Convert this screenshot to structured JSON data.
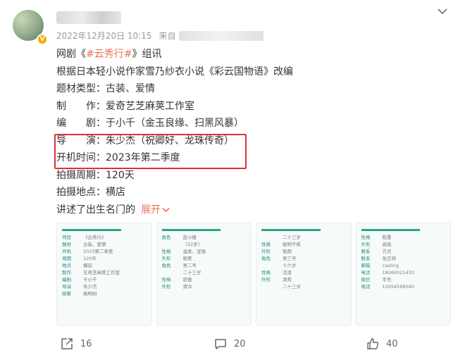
{
  "post": {
    "timestamp": "2022年12月20日 10:15",
    "source_prefix": "来自",
    "lines": [
      {
        "pre": "网剧《",
        "tag": "#云秀行#",
        "post": "》组讯"
      },
      {
        "text": "根据日本轻小说作家雪乃纱衣小说《彩云国物语》改编"
      },
      {
        "text": "题材类型：古装、爱情"
      },
      {
        "text": "制　　作：爱奇艺芝麻荚工作室"
      },
      {
        "text": "编　　剧：于小千（金玉良缘、扫黑风暴）"
      },
      {
        "text": "导　　演：朱少杰（祝卿好、龙珠传奇）"
      },
      {
        "text": "开机时间：2023年第二季度"
      },
      {
        "text": "拍摄周期：120天"
      },
      {
        "text": "拍摄地点：横店"
      },
      {
        "text": "讲述了出生名门的"
      }
    ],
    "expand_label": "展开"
  },
  "gallery": [
    {
      "rows": [
        [
          "项目",
          "《云秀行》"
        ],
        [
          "题材",
          "古装、爱情"
        ],
        [
          "开机",
          "2023第二季度"
        ],
        [
          "周期",
          "120天"
        ],
        [
          "地点",
          "横店"
        ],
        [
          "制作",
          "艺奇芝麻荚工作室"
        ],
        [
          "编剧",
          "于小千"
        ],
        [
          "导演",
          "朱少杰"
        ],
        [
          "统筹",
          "杨明树"
        ]
      ]
    },
    {
      "rows": [
        [
          "角色",
          "蓝小楼"
        ],
        [
          "",
          "（22岁）"
        ],
        [
          "性格",
          "温柔、坚强"
        ],
        [
          "外形",
          "貌美"
        ],
        [
          "角色",
          "男二号"
        ],
        [
          "",
          "二十三岁"
        ],
        [
          "性格",
          "骄傲"
        ],
        [
          "外形",
          "清冷"
        ]
      ]
    },
    {
      "rows": [
        [
          "",
          "二十三岁"
        ],
        [
          "性格",
          "聪明干练"
        ],
        [
          "外形",
          "俊朗"
        ],
        [
          "角色",
          "男三号"
        ],
        [
          "",
          "十六岁"
        ],
        [
          "性格",
          "活泼"
        ],
        [
          "外形",
          "清秀"
        ],
        [
          "",
          "二十三岁"
        ]
      ]
    },
    {
      "rows": [
        [
          "性格",
          "稳重"
        ],
        [
          "外形",
          "高挑"
        ],
        [
          "联系",
          "方式"
        ],
        [
          "联系",
          "张正祥"
        ],
        [
          "邮箱",
          "casting"
        ],
        [
          "电话",
          "18260021433"
        ],
        [
          "微信",
          "宇先"
        ],
        [
          "电话",
          "15054599560"
        ]
      ]
    }
  ],
  "actions": {
    "share_count": "16",
    "comment_count": "20",
    "like_count": "40"
  },
  "colors": {
    "accent": "#eb7350",
    "highlight_border": "#e0302f",
    "verified_badge": "#f7a600",
    "card_accent": "#2aa58f"
  },
  "icons": {
    "more": "chevron-down-icon",
    "share": "share-icon",
    "comment": "comment-icon",
    "like": "thumbs-up-icon",
    "verified": "verified-v-icon"
  }
}
